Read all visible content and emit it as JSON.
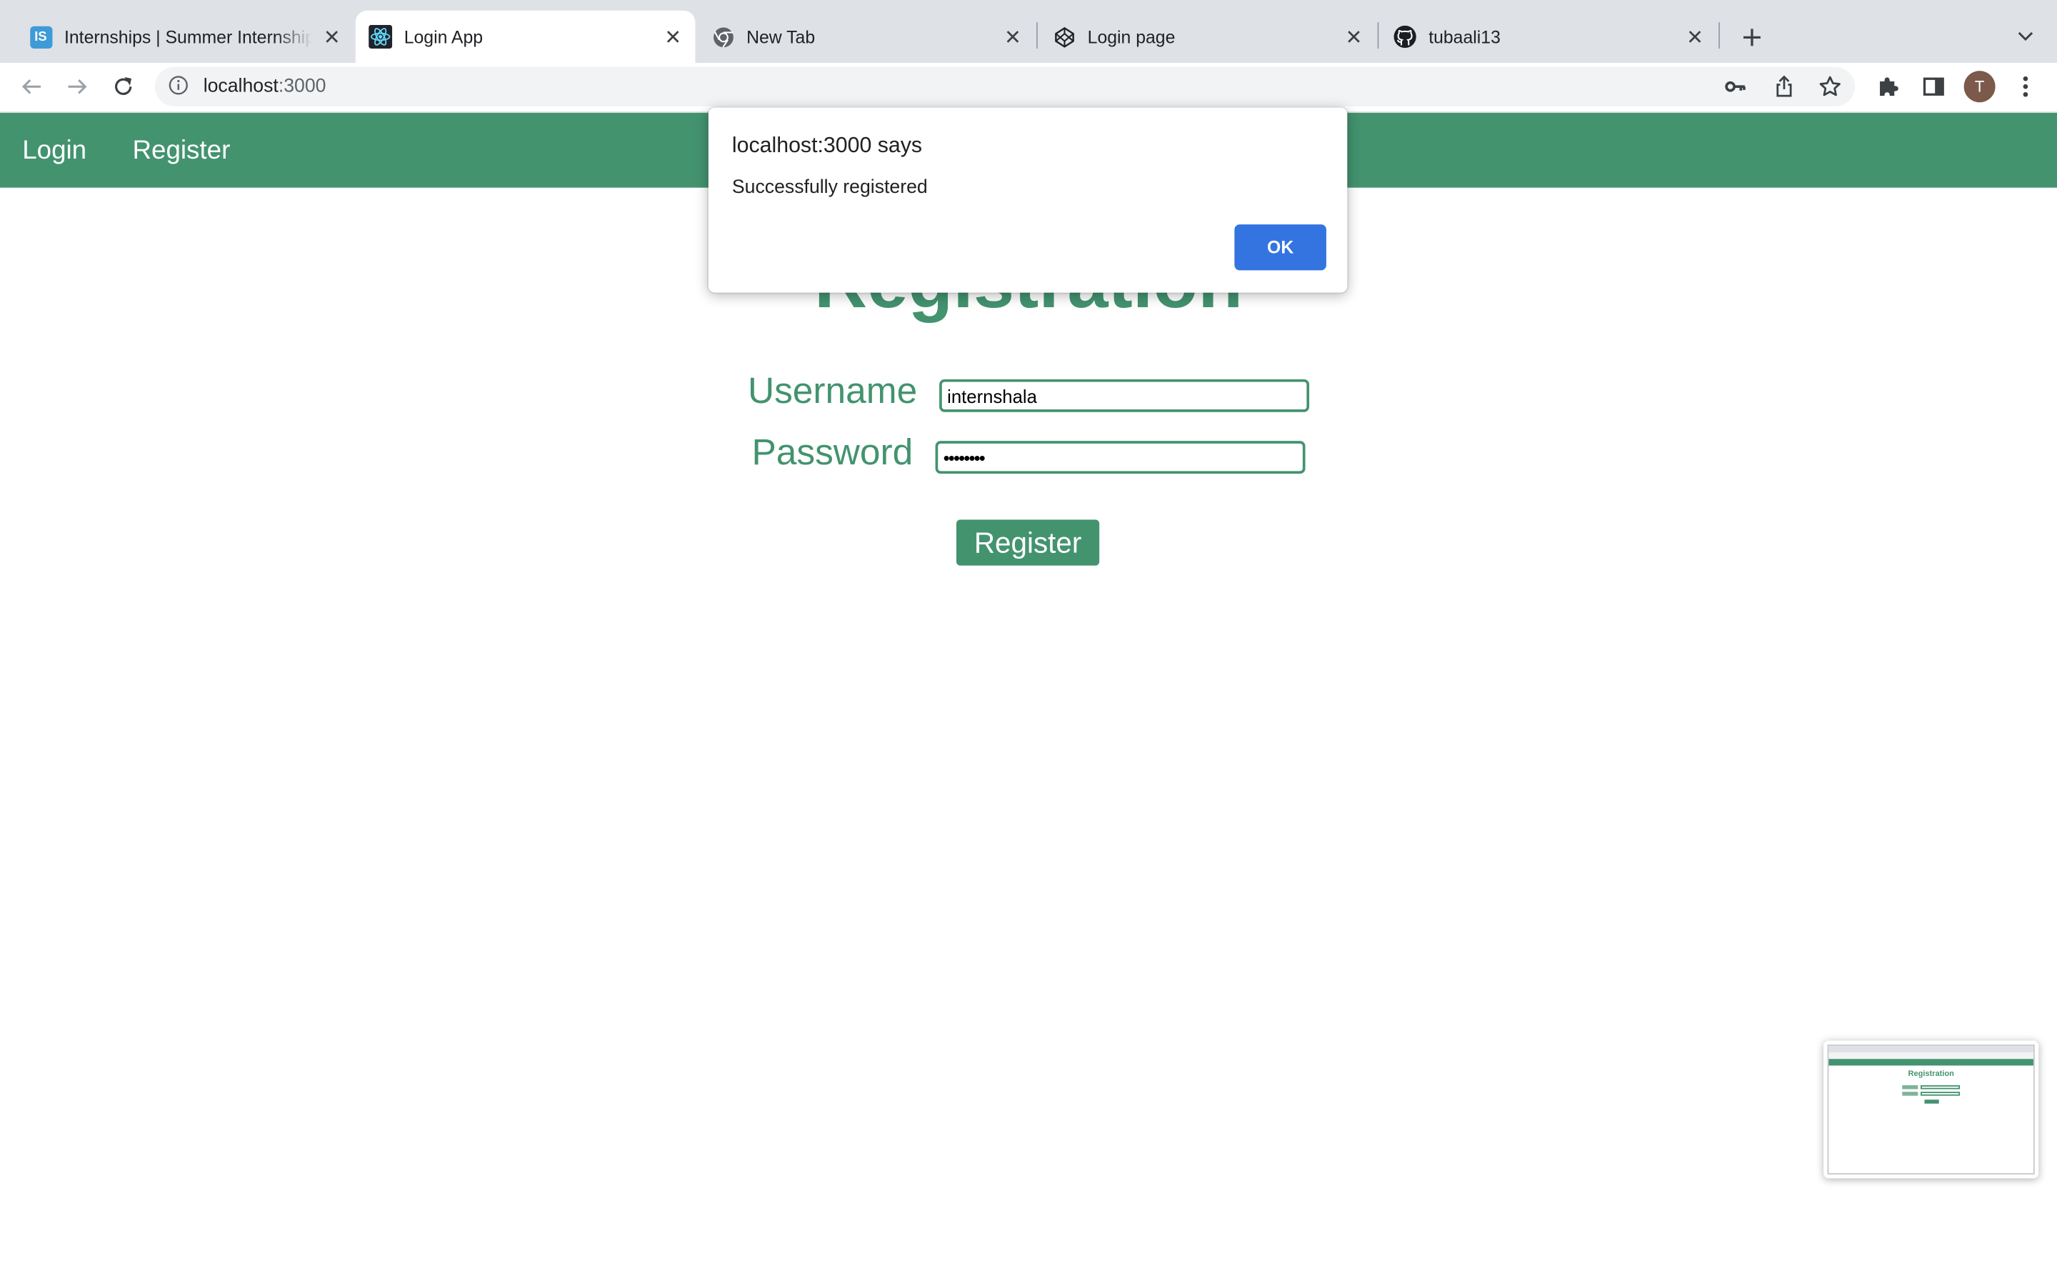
{
  "browser": {
    "tabs": [
      {
        "title": "Internships | Summer Internships",
        "favicon": "internshala-icon",
        "active": false
      },
      {
        "title": "Login App",
        "favicon": "react-icon",
        "active": true
      },
      {
        "title": "New Tab",
        "favicon": "chrome-icon",
        "active": false
      },
      {
        "title": "Login page",
        "favicon": "codepen-icon",
        "active": false
      },
      {
        "title": "tubaali13",
        "favicon": "github-icon",
        "active": false
      }
    ],
    "address": {
      "host": "localhost",
      "port": ":3000"
    },
    "profile_initial": "T"
  },
  "navbar": {
    "login_label": "Login",
    "register_label": "Register",
    "color": "#43936f"
  },
  "form": {
    "heading": "Registration",
    "username_label": "Username",
    "username_value": "internshala",
    "password_label": "Password",
    "password_value": "••••••••",
    "submit_label": "Register"
  },
  "dialog": {
    "origin": "localhost:3000 says",
    "message": "Successfully registered",
    "ok_label": "OK",
    "button_color": "#3474e0"
  },
  "thumbnail": {
    "title": "Registration"
  }
}
